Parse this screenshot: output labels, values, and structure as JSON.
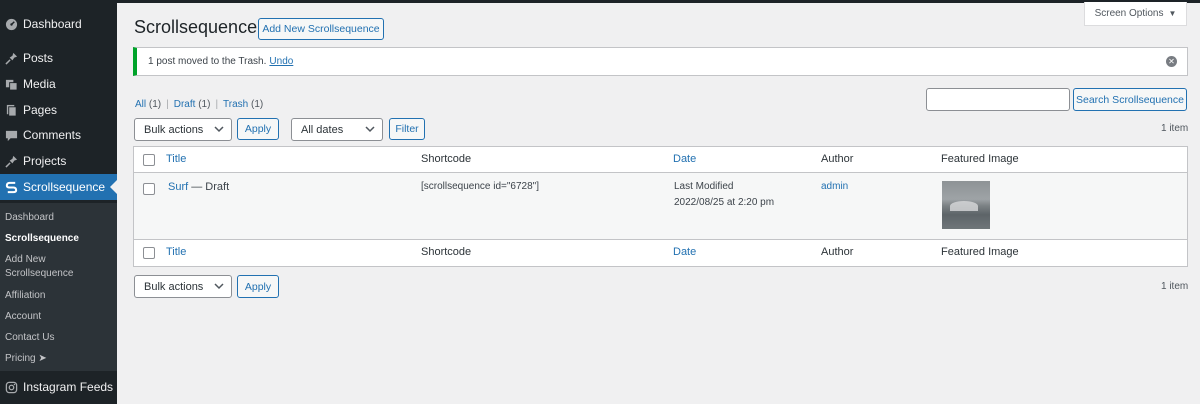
{
  "sidebar": {
    "items": [
      {
        "label": "Dashboard",
        "icon": "dashboard-icon"
      },
      {
        "label": "Posts",
        "icon": "pin-icon"
      },
      {
        "label": "Media",
        "icon": "media-icon"
      },
      {
        "label": "Pages",
        "icon": "pages-icon"
      },
      {
        "label": "Comments",
        "icon": "comments-icon"
      },
      {
        "label": "Projects",
        "icon": "pin-icon"
      },
      {
        "label": "Scrollsequence",
        "icon": "scrollsequence-icon"
      },
      {
        "label": "Instagram Feeds",
        "icon": "instagram-icon"
      }
    ],
    "submenu": [
      "Dashboard",
      "Scrollsequence",
      "Add New Scrollsequence",
      "Affiliation",
      "Account",
      "Contact Us",
      "Pricing ➤"
    ]
  },
  "header": {
    "title": "Scrollsequence",
    "add_new": "Add New Scrollsequence",
    "screen_options": "Screen Options"
  },
  "notice": {
    "text": "1 post moved to the Trash.",
    "undo": "Undo"
  },
  "views": {
    "all": "All",
    "all_count": "(1)",
    "draft": "Draft",
    "draft_count": "(1)",
    "trash": "Trash",
    "trash_count": "(1)"
  },
  "search": {
    "value": "",
    "button": "Search Scrollsequence"
  },
  "top_nav": {
    "bulk_actions": "Bulk actions",
    "apply": "Apply",
    "dates": "All dates",
    "filter": "Filter",
    "count": "1 item"
  },
  "bottom_nav": {
    "bulk_actions": "Bulk actions",
    "apply": "Apply",
    "count": "1 item"
  },
  "table": {
    "columns": {
      "title": "Title",
      "shortcode": "Shortcode",
      "date": "Date",
      "author": "Author",
      "featured_image": "Featured Image"
    },
    "rows": [
      {
        "title": "Surf",
        "state": "— Draft",
        "shortcode": "[scrollsequence id=\"6728\"]",
        "date_label": "Last Modified",
        "date": "2022/08/25 at 2:20 pm",
        "author": "admin"
      }
    ]
  },
  "colors": {
    "admin_dark": "#1d2327",
    "accent": "#2271b1",
    "success": "#00a32a"
  }
}
